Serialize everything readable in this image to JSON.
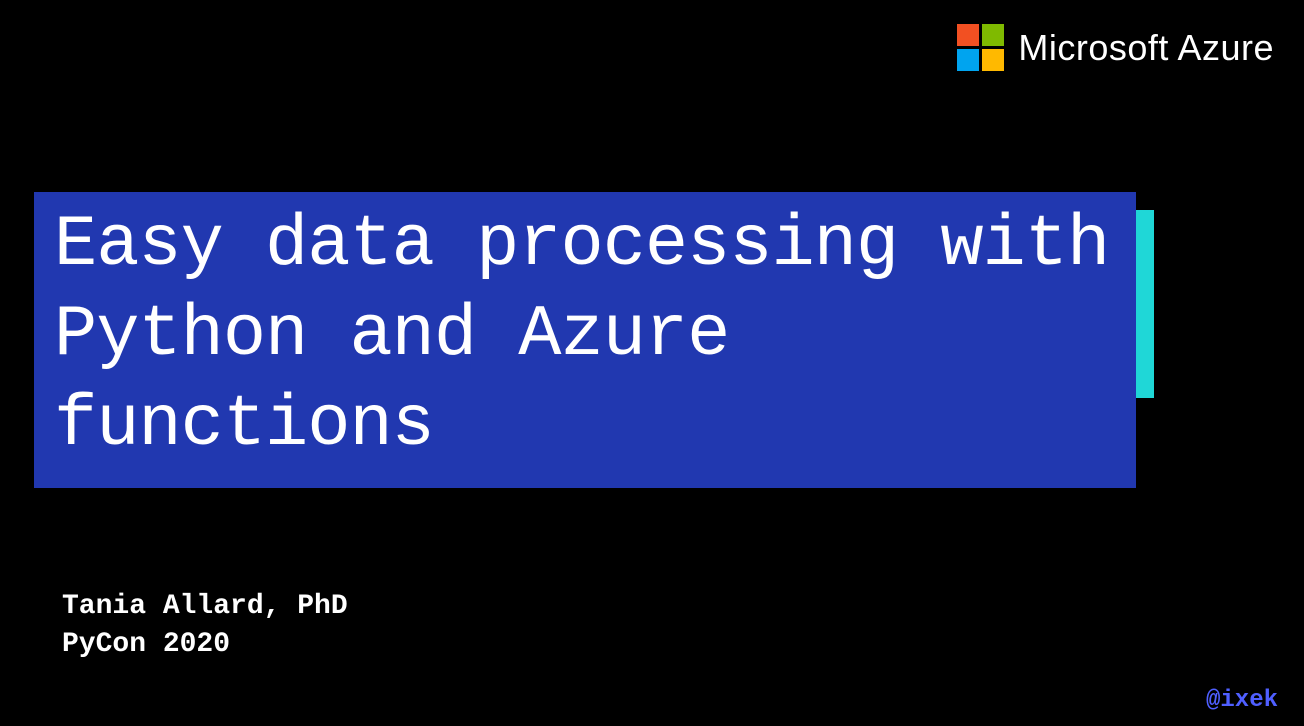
{
  "header": {
    "brand": "Microsoft Azure"
  },
  "title": {
    "text": "Easy data processing with Python and Azure functions"
  },
  "author": {
    "name": "Tania Allard, PhD",
    "event": "PyCon 2020"
  },
  "social": {
    "handle": "@ixek"
  },
  "colors": {
    "background": "#000000",
    "title_bg": "#2138b0",
    "title_shadow": "#1fd7d7",
    "handle": "#4f5fff",
    "ms_red": "#f25022",
    "ms_green": "#7fba00",
    "ms_blue": "#00a4ef",
    "ms_yellow": "#ffb900"
  }
}
